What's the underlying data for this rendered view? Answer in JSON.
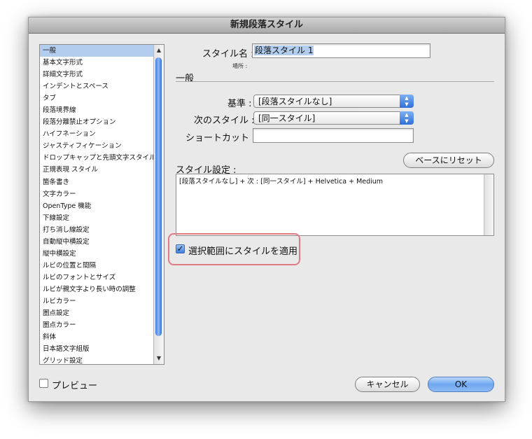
{
  "window": {
    "title": "新規段落スタイル"
  },
  "sidebar": {
    "selected_index": 0,
    "items": [
      "一般",
      "基本文字形式",
      "詳細文字形式",
      "インデントとスペース",
      "タブ",
      "段落境界線",
      "段落分離禁止オプション",
      "ハイフネーション",
      "ジャスティフィケーション",
      "ドロップキャップと先頭文字スタイル",
      "正規表現 スタイル",
      "箇条書き",
      "文字カラー",
      "OpenType 機能",
      "下線設定",
      "打ち消し線設定",
      "自動縦中横設定",
      "縦中横設定",
      "ルビの位置と間隔",
      "ルビのフォントとサイズ",
      "ルビが親文字より長い時の調整",
      "ルビカラー",
      "圏点設定",
      "圏点カラー",
      "斜体",
      "日本語文字組版",
      "グリッド設定"
    ],
    "scroll_up_icon": "▲",
    "scroll_down_icon": "▼"
  },
  "form": {
    "style_name_label": "スタイル名 :",
    "style_name_value": "段落スタイル 1",
    "location_label": "場所 :",
    "section_title": "一般",
    "based_on_label": "基準 :",
    "based_on_value": "[段落スタイルなし]",
    "next_style_label": "次のスタイル :",
    "next_style_value": "[同一スタイル]",
    "shortcut_label": "ショートカット :",
    "shortcut_value": "",
    "reset_button": "ベースにリセット",
    "style_settings_label": "スタイル設定 :",
    "style_settings_text": "[段落スタイルなし] + 次 : [同一スタイル] + Helvetica + Medium",
    "apply_checkbox_label": "選択範囲にスタイルを適用",
    "apply_checked": true,
    "popup_arrow_up": "▲",
    "popup_arrow_down": "▼",
    "check_mark": "✓"
  },
  "footer": {
    "preview_label": "プレビュー",
    "preview_checked": false,
    "cancel_button": "キャンセル",
    "ok_button": "OK"
  },
  "colors": {
    "accent": "#3d7fe0",
    "highlight_border": "#e07a83",
    "selection": "#b3cdee"
  }
}
